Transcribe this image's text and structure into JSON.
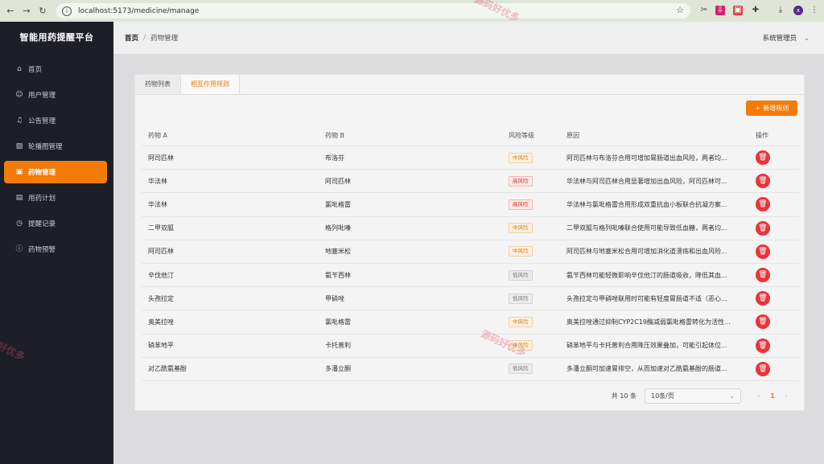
{
  "browser": {
    "url": "localhost:5173/medicine/manage",
    "back_icon": "arrow-left",
    "forward_icon": "arrow-right",
    "reload_icon": "reload"
  },
  "sidebar": {
    "brand": "智能用药提醒平台",
    "items": [
      {
        "label": "首页",
        "icon": "home-icon"
      },
      {
        "label": "用户管理",
        "icon": "user-icon"
      },
      {
        "label": "公告管理",
        "icon": "bell-icon"
      },
      {
        "label": "轮播图管理",
        "icon": "image-icon"
      },
      {
        "label": "药物管理",
        "icon": "medicine-icon",
        "active": true
      },
      {
        "label": "用药计划",
        "icon": "plan-icon"
      },
      {
        "label": "提醒记录",
        "icon": "clock-icon"
      },
      {
        "label": "药物预警",
        "icon": "warning-icon"
      }
    ]
  },
  "header": {
    "breadcrumb_home": "首页",
    "breadcrumb_sep": "/",
    "breadcrumb_current": "药物管理",
    "user": "系统管理员"
  },
  "tabs": [
    {
      "label": "药物列表"
    },
    {
      "label": "相互作用规则",
      "active": true
    }
  ],
  "add_button": "新增规则",
  "table": {
    "headers": {
      "drug_a": "药物 A",
      "drug_b": "药物 B",
      "risk": "风险等级",
      "reason": "原因",
      "ops": "操作"
    },
    "rows": [
      {
        "a": "阿司匹林",
        "b": "布洛芬",
        "risk": "中风险",
        "level": "mid",
        "reason": "阿司匹林与布洛芬合用可增加胃肠道出血风险，两者均..."
      },
      {
        "a": "华法林",
        "b": "阿司匹林",
        "risk": "高风险",
        "level": "high",
        "reason": "华法林与阿司匹林合用显著增加出血风险，阿司匹林可..."
      },
      {
        "a": "华法林",
        "b": "氯吡格雷",
        "risk": "高风险",
        "level": "high",
        "reason": "华法林与氯吡格雷合用形成双重抗血小板联合抗凝方案..."
      },
      {
        "a": "二甲双胍",
        "b": "格列吡嗪",
        "risk": "中风险",
        "level": "mid",
        "reason": "二甲双胍与格列吡嗪联合使用可能导致低血糖，两者均..."
      },
      {
        "a": "阿司匹林",
        "b": "地塞米松",
        "risk": "中风险",
        "level": "mid",
        "reason": "阿司匹林与地塞米松合用可增加消化道溃疡和出血风险..."
      },
      {
        "a": "辛伐他汀",
        "b": "氨苄西林",
        "risk": "低风险",
        "level": "low",
        "reason": "氨苄西林可能轻微影响辛伐他汀的肠道吸收，降低其血..."
      },
      {
        "a": "头孢拉定",
        "b": "甲硝唑",
        "risk": "低风险",
        "level": "low",
        "reason": "头孢拉定与甲硝唑联用时可能有轻度胃肠道不适（恶心..."
      },
      {
        "a": "奥美拉唑",
        "b": "氯吡格雷",
        "risk": "中风险",
        "level": "mid",
        "reason": "奥美拉唑通过抑制CYP2C19酶减弱氯吡格雷转化为活性..."
      },
      {
        "a": "硝苯地平",
        "b": "卡托普利",
        "risk": "中风险",
        "level": "mid",
        "reason": "硝苯地平与卡托普利合用降压效果叠加，可能引起体位..."
      },
      {
        "a": "对乙酰氨基酚",
        "b": "多潘立酮",
        "risk": "低风险",
        "level": "low",
        "reason": "多潘立酮可加速胃排空，从而加速对乙酰氨基酚的肠道..."
      }
    ]
  },
  "pagination": {
    "total": "共 10 条",
    "page_size": "10条/页",
    "current": "1"
  },
  "colors": {
    "accent": "#f47b07",
    "danger": "#e8353b",
    "sidebar_bg": "#1d1e26"
  },
  "watermarks": [
    "源码好优多",
    "源码好优多",
    "好优多"
  ]
}
